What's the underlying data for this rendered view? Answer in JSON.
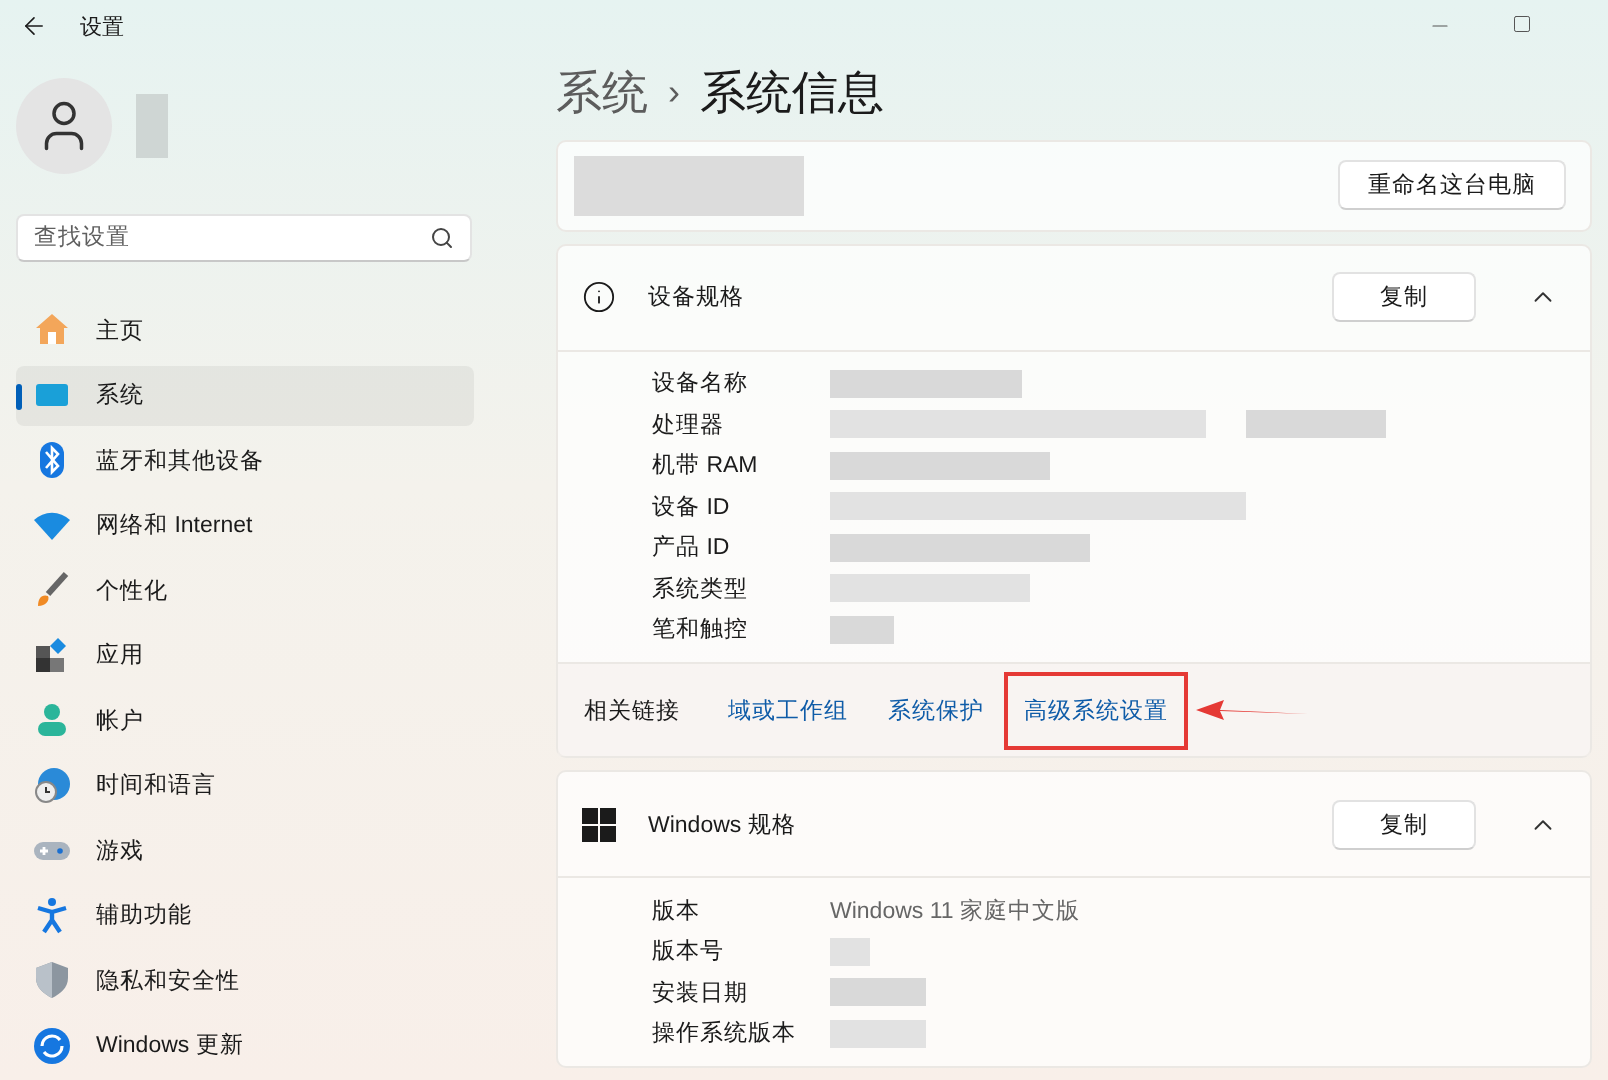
{
  "window": {
    "title": "设置"
  },
  "search": {
    "placeholder": "查找设置"
  },
  "sidebar": {
    "items": [
      {
        "label": "主页",
        "selected": false
      },
      {
        "label": "系统",
        "selected": true
      },
      {
        "label": "蓝牙和其他设备",
        "selected": false
      },
      {
        "label": "网络和 Internet",
        "selected": false
      },
      {
        "label": "个性化",
        "selected": false
      },
      {
        "label": "应用",
        "selected": false
      },
      {
        "label": "帐户",
        "selected": false
      },
      {
        "label": "时间和语言",
        "selected": false
      },
      {
        "label": "游戏",
        "selected": false
      },
      {
        "label": "辅助功能",
        "selected": false
      },
      {
        "label": "隐私和安全性",
        "selected": false
      },
      {
        "label": "Windows 更新",
        "selected": false
      }
    ]
  },
  "breadcrumb": {
    "parent": "系统",
    "separator": "›",
    "current": "系统信息"
  },
  "rename_button": "重命名这台电脑",
  "sections": [
    {
      "kind": "info",
      "title": "设备规格",
      "copy_button": "复制",
      "expanded": true,
      "rows": [
        {
          "label": "设备名称"
        },
        {
          "label": "处理器"
        },
        {
          "label": "机带 RAM"
        },
        {
          "label": "设备 ID"
        },
        {
          "label": "产品 ID"
        },
        {
          "label": "系统类型"
        },
        {
          "label": "笔和触控"
        }
      ],
      "related": {
        "label": "相关链接",
        "links": [
          {
            "text": "域或工作组",
            "highlighted": false
          },
          {
            "text": "系统保护",
            "highlighted": false
          },
          {
            "text": "高级系统设置",
            "highlighted": true
          }
        ]
      }
    },
    {
      "kind": "windows",
      "title": "Windows 规格",
      "copy_button": "复制",
      "expanded": true,
      "rows": [
        {
          "label": "版本",
          "value": "Windows 11 家庭中文版"
        },
        {
          "label": "版本号"
        },
        {
          "label": "安装日期"
        },
        {
          "label": "操作系统版本"
        }
      ]
    }
  ]
}
